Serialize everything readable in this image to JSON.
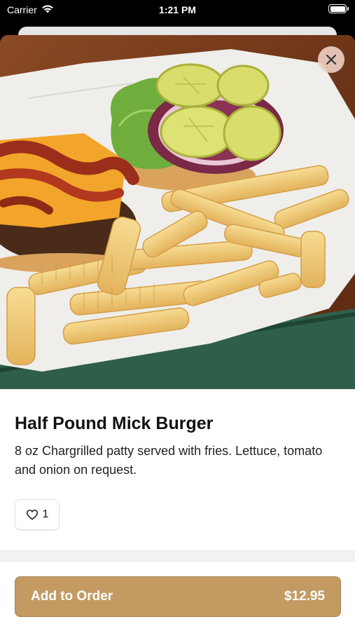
{
  "status_bar": {
    "carrier": "Carrier",
    "time": "1:21 PM",
    "icons": [
      "wifi-icon",
      "battery-icon"
    ]
  },
  "item": {
    "name": "Half Pound Mick Burger",
    "description": "8 oz Chargrilled patty served with fries.  Lettuce, tomato and onion on request.",
    "likes": "1",
    "image_subject": "burger-with-bacon-and-crinkle-fries"
  },
  "actions": {
    "close_icon": "close-icon",
    "like_icon": "heart-icon",
    "add_to_order_label": "Add to Order",
    "price": "$12.95"
  },
  "colors": {
    "accent": "#c29a62",
    "close_button_bg": "#eccdc1",
    "text": "#111111"
  }
}
